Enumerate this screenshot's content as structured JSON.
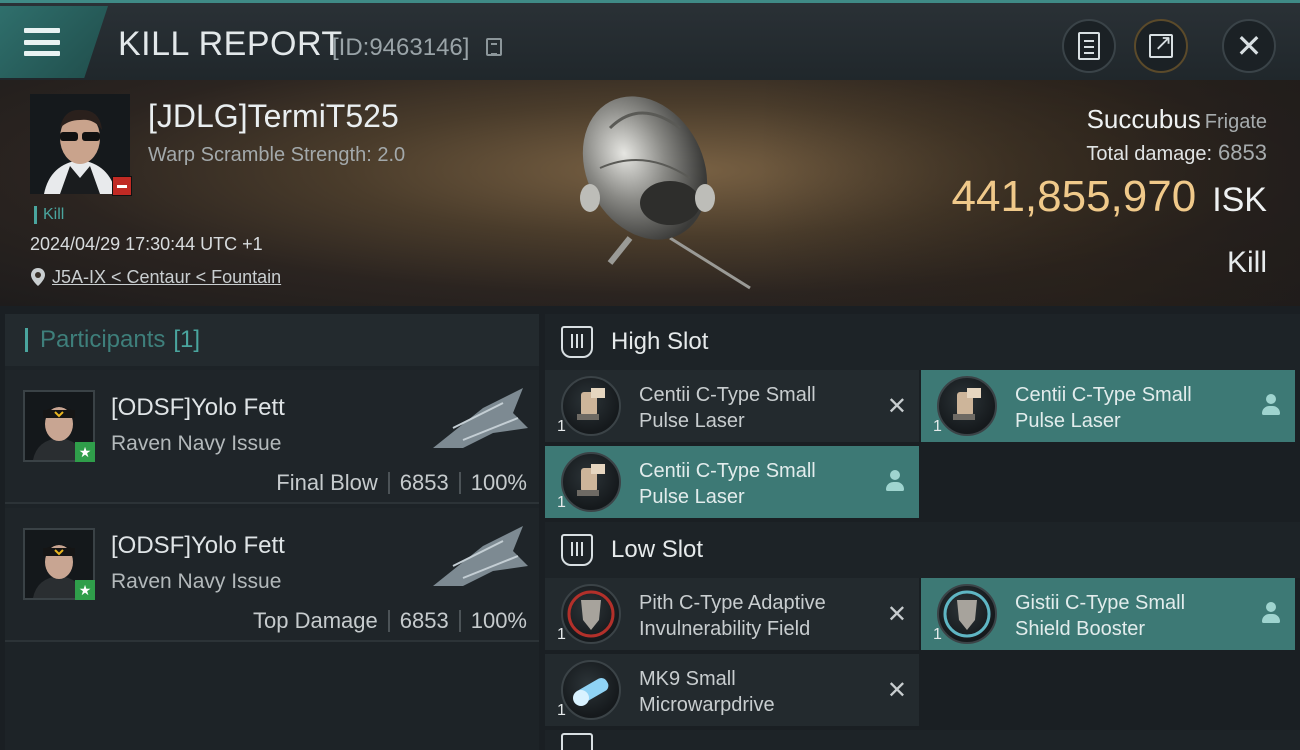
{
  "header": {
    "title": "KILL REPORT",
    "report_id": "[ID:9463146]"
  },
  "victim": {
    "name": "[JDLG]TermiT525",
    "warp_scramble": "Warp Scramble Strength: 2.0",
    "tag": "Kill",
    "datetime": "2024/04/29 17:30:44 UTC +1",
    "location": "J5A-IX < Centaur < Fountain",
    "ship_name": "Succubus",
    "ship_class": "Frigate",
    "total_damage_label": "Total damage:",
    "total_damage_value": "6853",
    "isk_value": "441,855,970",
    "isk_unit": "ISK",
    "result": "Kill"
  },
  "participants": {
    "label": "Participants",
    "count": "[1]",
    "rows": [
      {
        "name": "[ODSF]Yolo Fett",
        "ship": "Raven Navy Issue",
        "role": "Final Blow",
        "damage": "6853",
        "percent": "100%"
      },
      {
        "name": "[ODSF]Yolo Fett",
        "ship": "Raven Navy Issue",
        "role": "Top Damage",
        "damage": "6853",
        "percent": "100%"
      }
    ]
  },
  "fitting": {
    "high_slot": {
      "label": "High Slot",
      "modules": [
        {
          "name_line1": "Centii C-Type Small",
          "name_line2": "Pulse Laser",
          "qty": "1",
          "status": "destroyed"
        },
        {
          "name_line1": "Centii C-Type Small",
          "name_line2": "Pulse Laser",
          "qty": "1",
          "status": "dropped"
        },
        {
          "name_line1": "Centii C-Type Small",
          "name_line2": "Pulse Laser",
          "qty": "1",
          "status": "dropped"
        }
      ]
    },
    "low_slot": {
      "label": "Low Slot",
      "modules": [
        {
          "name_line1": "Pith C-Type Adaptive",
          "name_line2": "Invulnerability Field",
          "qty": "1",
          "status": "destroyed"
        },
        {
          "name_line1": "Gistii C-Type Small",
          "name_line2": "Shield Booster",
          "qty": "1",
          "status": "dropped"
        },
        {
          "name_line1": "MK9 Small",
          "name_line2": "Microwarpdrive",
          "qty": "1",
          "status": "destroyed"
        }
      ]
    }
  },
  "colors": {
    "accent_teal": "#3d7975",
    "isk_gold": "#f0c98a",
    "badge_red": "#c02a24",
    "badge_green": "#2f9e4a"
  },
  "icons": [
    "menu-icon",
    "copy-icon",
    "clipboard-icon",
    "share-icon",
    "close-icon",
    "location-pin-icon",
    "slot-icon",
    "remove-icon",
    "user-icon"
  ]
}
